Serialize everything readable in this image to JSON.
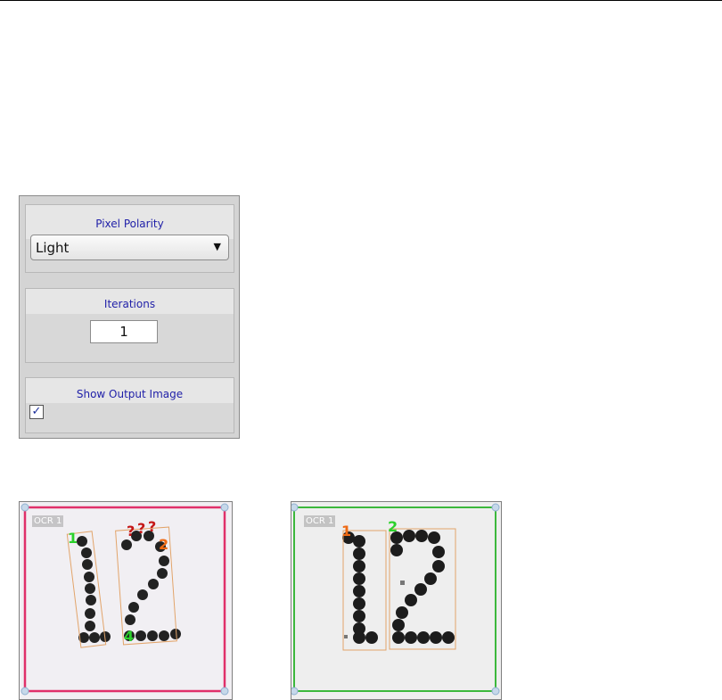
{
  "settings": {
    "pixel_polarity": {
      "label": "Pixel Polarity",
      "value": "Light"
    },
    "iterations": {
      "label": "Iterations",
      "value": "1"
    },
    "show_output_image": {
      "label": "Show Output Image",
      "checked": true,
      "check_glyph": "✓"
    }
  },
  "images": [
    {
      "tag": "OCR 1",
      "border_color": "#e0306a",
      "char_labels": [
        {
          "text": "1",
          "color": "green"
        },
        {
          "text": "?",
          "color": "red"
        },
        {
          "text": "?",
          "color": "red"
        },
        {
          "text": "?",
          "color": "red"
        },
        {
          "text": "2",
          "color": "orange"
        },
        {
          "text": "4",
          "color": "green"
        }
      ]
    },
    {
      "tag": "OCR 1",
      "border_color": "#3cb83c",
      "char_labels": [
        {
          "text": "1",
          "color": "orange"
        },
        {
          "text": "2",
          "color": "green"
        }
      ]
    }
  ]
}
